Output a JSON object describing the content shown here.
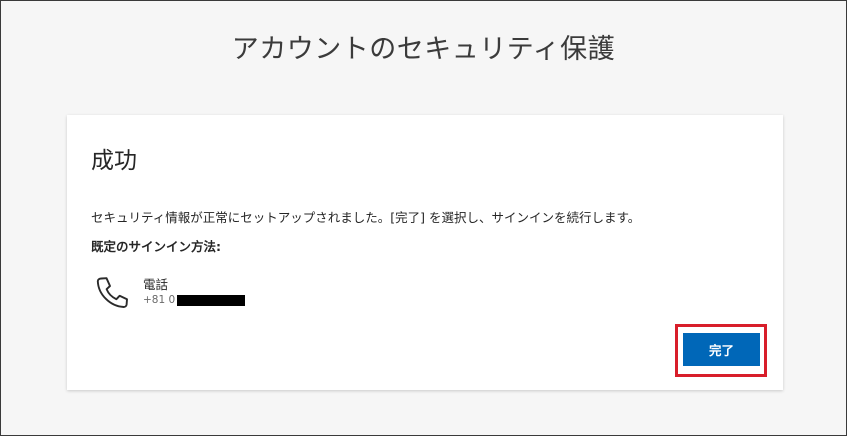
{
  "page": {
    "title": "アカウントのセキュリティ保護"
  },
  "card": {
    "heading": "成功",
    "message": "セキュリティ情報が正常にセットアップされました。[完了] を選択し、サインインを続行します。",
    "default_method_label": "既定のサインイン方法:",
    "method": {
      "icon": "phone-icon",
      "name": "電話",
      "number_prefix": "+81 0"
    },
    "done_label": "完了"
  },
  "colors": {
    "button_bg": "#0067b8",
    "highlight": "#d81e2a",
    "page_bg": "#f6f6f6"
  }
}
